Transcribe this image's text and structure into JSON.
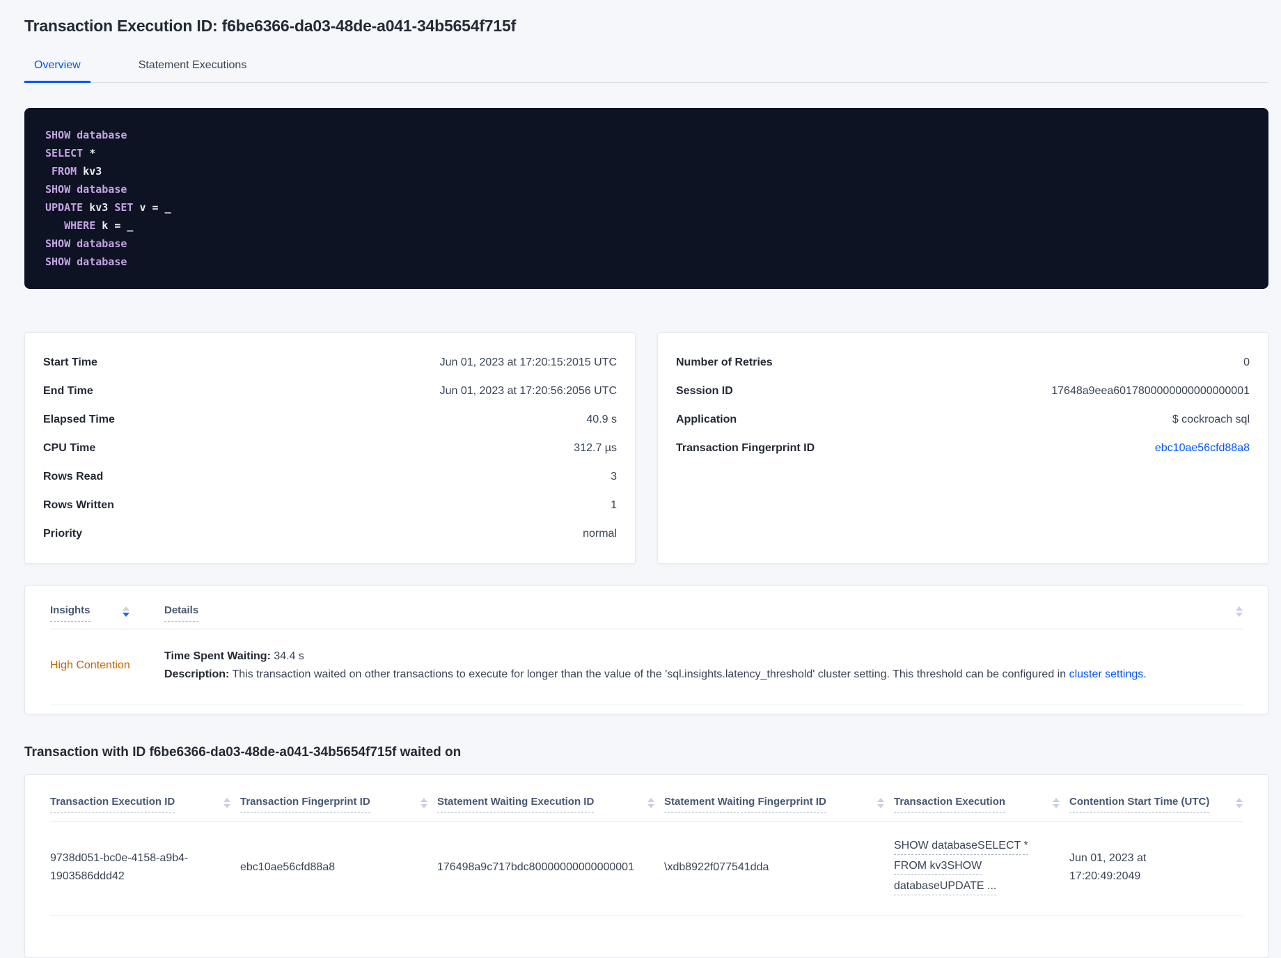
{
  "colors": {
    "accent_blue": "#0055ff",
    "insight_orange": "#c26400",
    "code_keyword_purple": "#c5a3e3",
    "code_background": "#0d1323"
  },
  "header": {
    "title": "Transaction Execution ID: f6be6366-da03-48de-a041-34b5654f715f",
    "tabs": [
      {
        "label": "Overview",
        "active": true
      },
      {
        "label": "Statement Executions",
        "active": false
      }
    ]
  },
  "sql": {
    "lines": [
      [
        {
          "t": "SHOW database"
        }
      ],
      [
        {
          "t": "SELECT"
        },
        {
          "t": " *"
        }
      ],
      [
        {
          "t": " FROM"
        },
        {
          "t": " kv3"
        }
      ],
      [
        {
          "t": "SHOW database"
        }
      ],
      [
        {
          "t": "UPDATE"
        },
        {
          "t": " kv3"
        },
        {
          "t": " SET"
        },
        {
          "t": " v = _"
        }
      ],
      [
        {
          "t": "   WHERE"
        },
        {
          "t": " k = _"
        }
      ],
      [
        {
          "t": "SHOW database"
        }
      ],
      [
        {
          "t": "SHOW database"
        }
      ]
    ]
  },
  "overview_card": {
    "rows": [
      {
        "label": "Start Time",
        "value": "Jun 01, 2023 at 17:20:15:2015 UTC"
      },
      {
        "label": "End Time",
        "value": "Jun 01, 2023 at 17:20:56:2056 UTC"
      },
      {
        "label": "Elapsed Time",
        "value": "40.9 s"
      },
      {
        "label": "CPU Time",
        "value": "312.7 µs"
      },
      {
        "label": "Rows Read",
        "value": "3"
      },
      {
        "label": "Rows Written",
        "value": "1"
      },
      {
        "label": "Priority",
        "value": "normal"
      }
    ]
  },
  "details_card": {
    "rows": [
      {
        "label": "Number of Retries",
        "value": "0"
      },
      {
        "label": "Session ID",
        "value": "17648a9eea6017800000000000000001"
      },
      {
        "label": "Application",
        "value": "$ cockroach sql"
      },
      {
        "label": "Transaction Fingerprint ID",
        "value": "ebc10ae56cfd88a8"
      }
    ]
  },
  "insights": {
    "columns": [
      "Insights",
      "Details"
    ],
    "row": {
      "insight": "High Contention",
      "time_label": "Time Spent Waiting:",
      "time_value": " 34.4 s",
      "desc_label": "Description:",
      "desc_text": " This transaction waited on other transactions to execute for longer than the value of the 'sql.insights.latency_threshold' cluster setting. This threshold can be configured in ",
      "desc_link": "cluster settings",
      "desc_suffix": "."
    }
  },
  "waited_on": {
    "heading": "Transaction with ID f6be6366-da03-48de-a041-34b5654f715f waited on",
    "columns": [
      "Transaction Execution ID",
      "Transaction Fingerprint ID",
      "Statement Waiting Execution ID",
      "Statement Waiting Fingerprint ID",
      "Transaction Execution",
      "Contention Start Time (UTC)"
    ],
    "row": {
      "transaction_execution_id": "9738d051-bc0e-4158-a9b4-1903586ddd42",
      "transaction_fingerprint_id": "ebc10ae56cfd88a8",
      "statement_waiting_execution_id": "176498a9c717bdc80000000000000001",
      "statement_waiting_fingerprint_id": "\\xdb8922f077541dda",
      "transaction_execution_lines": [
        "SHOW databaseSELECT *",
        "FROM kv3SHOW",
        "databaseUPDATE ..."
      ],
      "contention_start_time": "Jun 01, 2023 at 17:20:49:2049"
    }
  }
}
